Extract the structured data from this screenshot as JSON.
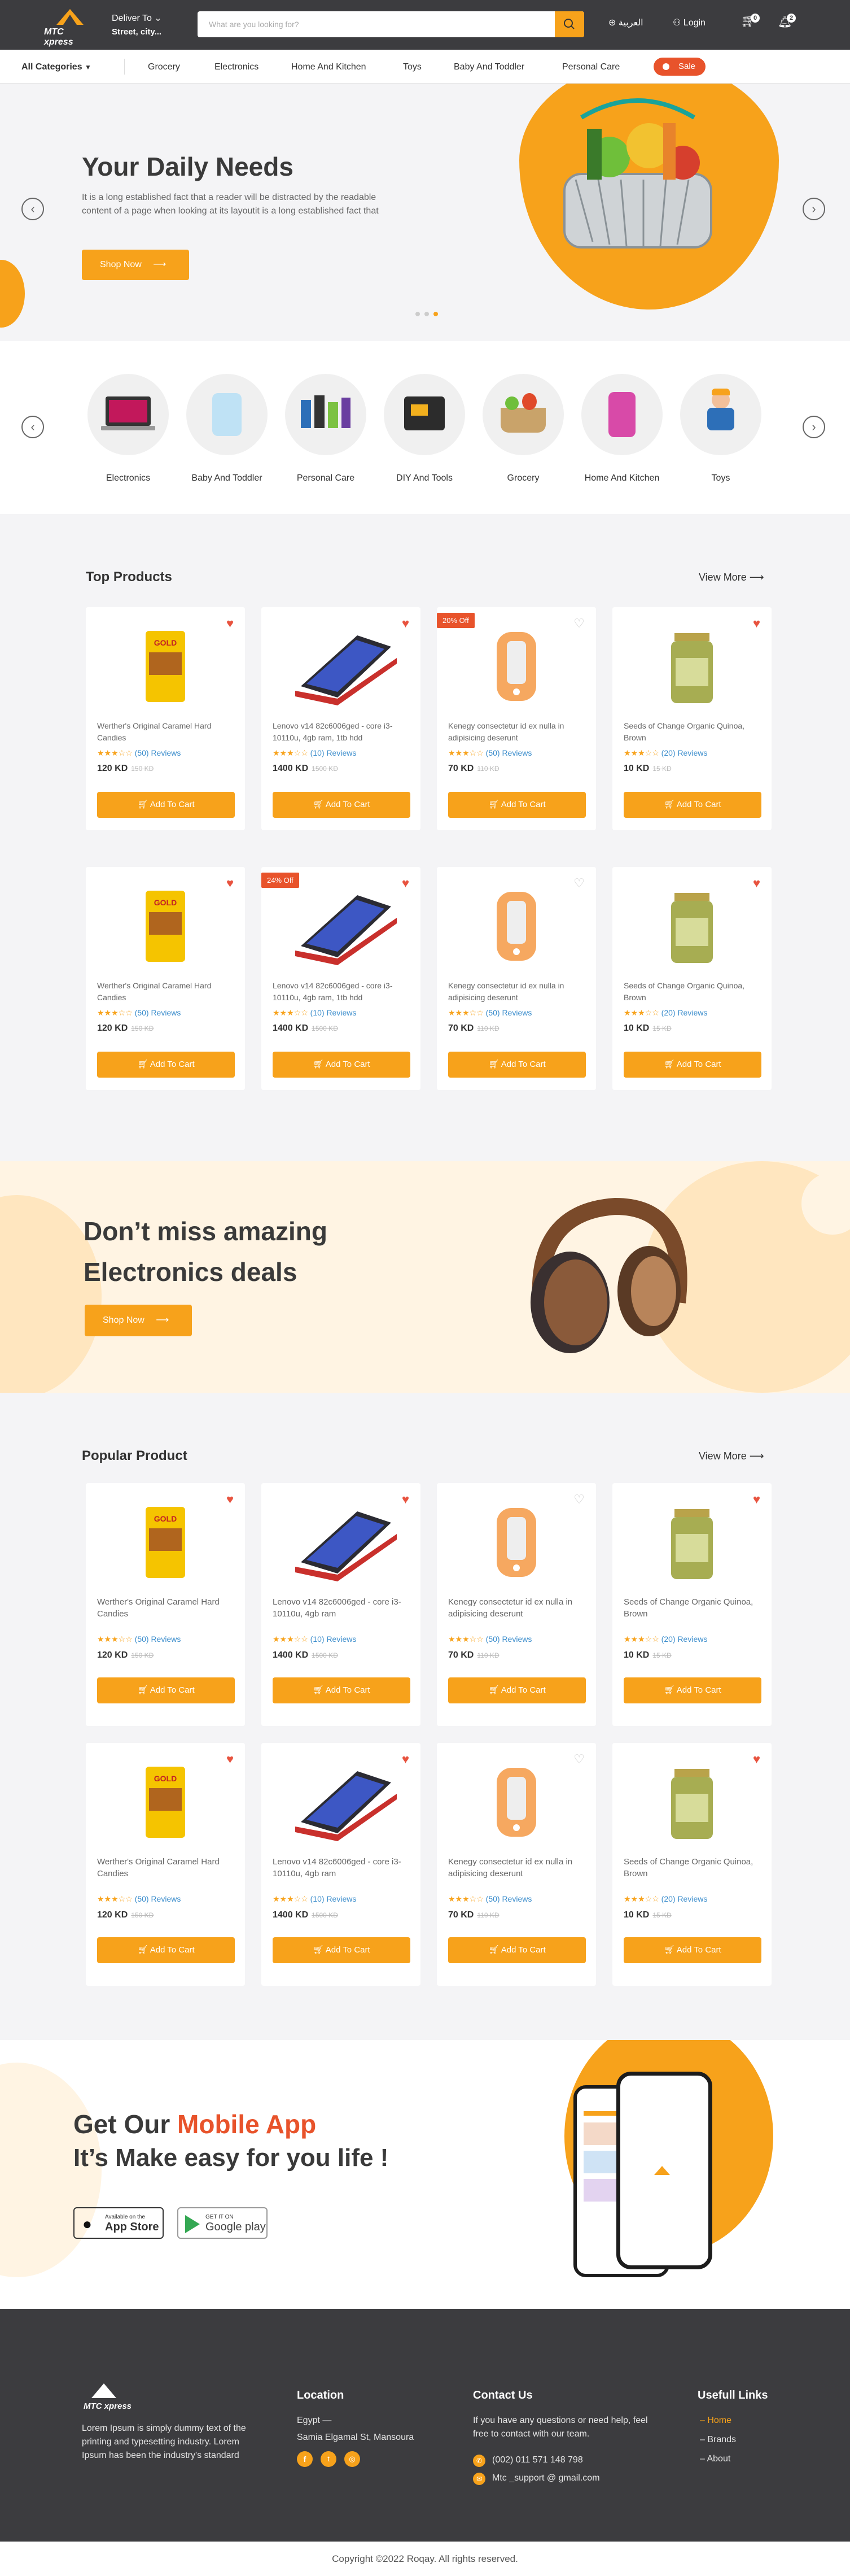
{
  "header": {
    "logo_text": "MTC xpress",
    "deliver_label": "Deliver To",
    "deliver_address": "Street, city...",
    "search_placeholder": "What are you looking for?",
    "language": "العربية",
    "login": "Login",
    "cart_count": "0",
    "notif_count": "2"
  },
  "nav": {
    "all_categories": "All Categories",
    "items": [
      "Grocery",
      "Electronics",
      "Home And Kitchen",
      "Toys",
      "Baby And Toddler",
      "Personal Care"
    ],
    "sale": "Sale"
  },
  "hero": {
    "title": "Your Daily Needs",
    "text": "It is a long established fact that a reader will be distracted by the readable content of a page when looking at its layoutit is a long established fact that",
    "button": "Shop Now"
  },
  "categories": [
    "Electronics",
    "Baby And Toddler",
    "Personal Care",
    "DIY And Tools",
    "Grocery",
    "Home And Kitchen",
    "Toys"
  ],
  "top_products": {
    "title": "Top Products",
    "view_more": "View More"
  },
  "popular": {
    "title": "Popular  Product",
    "view_more": "View More"
  },
  "products": [
    {
      "name": "Werther's Original Caramel Hard Candies",
      "rating": "★★★☆☆",
      "reviews": "(50) Reviews",
      "price": "120 KD",
      "old": "150 KD"
    },
    {
      "name": "Lenovo v14 82c6006ged - core i3-10110u, 4gb ram, 1tb hdd",
      "rating": "★★★☆☆",
      "reviews": "(10) Reviews",
      "price": "1400 KD",
      "old": "1500 KD"
    },
    {
      "name": "Kenegy consectetur id ex nulla in adipisicing deserunt",
      "rating": "★★★☆☆",
      "reviews": "(50) Reviews",
      "price": "70 KD",
      "old": "110 KD"
    },
    {
      "name": "Seeds of Change Organic Quinoa, Brown",
      "rating": "★★★☆☆",
      "reviews": "(20) Reviews",
      "price": "10 KD",
      "old": "15 KD"
    }
  ],
  "popular_products": [
    {
      "name": "Werther's Original Caramel Hard Candies",
      "rating": "★★★☆☆",
      "reviews": "(50) Reviews",
      "price": "120 KD",
      "old": "150 KD"
    },
    {
      "name": "Lenovo v14 82c6006ged - core i3-10110u, 4gb ram",
      "rating": "★★★☆☆",
      "reviews": "(10) Reviews",
      "price": "1400 KD",
      "old": "1500 KD"
    },
    {
      "name": "Kenegy consectetur id ex nulla in adipisicing deserunt",
      "rating": "★★★☆☆",
      "reviews": "(50) Reviews",
      "price": "70 KD",
      "old": "110 KD"
    },
    {
      "name": "Seeds of Change Organic Quinoa, Brown",
      "rating": "★★★☆☆",
      "reviews": "(20) Reviews",
      "price": "10 KD",
      "old": "15 KD"
    }
  ],
  "tags": {
    "off20": "20% Off",
    "off24": "24% Off"
  },
  "add_to_cart": "Add To Cart",
  "promo": {
    "line1": "Don’t miss amazing",
    "line2": "Electronics deals",
    "button": "Shop Now"
  },
  "app": {
    "line1a": "Get Our ",
    "line1b": "Mobile App",
    "line2": "It’s Make easy for you life !",
    "appstore_small": "Available on the",
    "appstore": "App Store",
    "gplay_small": "GET IT ON",
    "gplay": "Google play"
  },
  "footer": {
    "about": "Lorem Ipsum is simply dummy text of the printing and typesetting industry. Lorem Ipsum has been the industry's standard",
    "location_h": "Location",
    "location1": "Egypt  —",
    "location2": "Samia Elgamal St, Mansoura",
    "contact_h": "Contact Us",
    "contact_text": "If you have any questions or need help, feel free to contact with our team.",
    "phone": "(002) 011 571 148 798",
    "email": "Mtc _support @ gmail.com",
    "links_h": "Usefull Links",
    "links": [
      "Home",
      "Brands",
      "About"
    ]
  },
  "copyright": "Copyright ©2022 Roqay. All rights reserved.",
  "colors": {
    "accent": "#f7a21b",
    "sale": "#e8532b",
    "dark": "#3c3c3f"
  }
}
